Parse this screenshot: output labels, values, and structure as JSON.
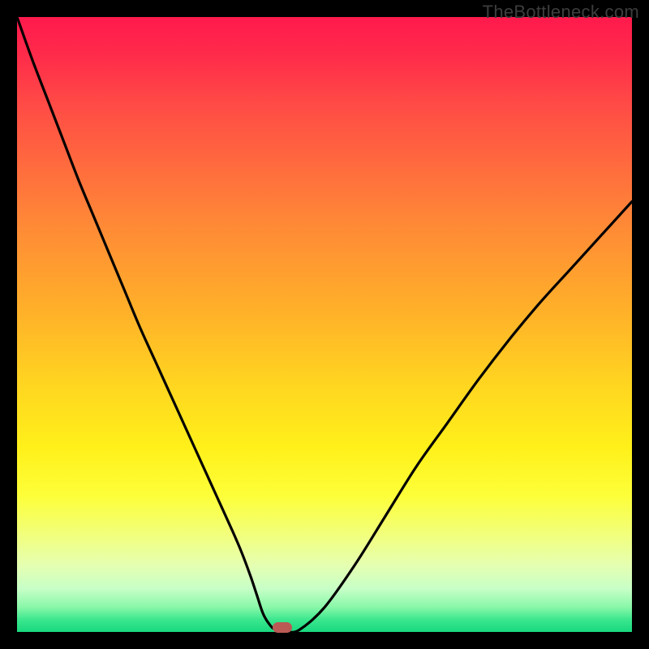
{
  "watermark": "TheBottleneck.com",
  "colors": {
    "frame": "#000000",
    "gradient_top": "#ff1a4d",
    "gradient_bottom": "#18d87e",
    "curve": "#000000",
    "marker": "#bb5a55"
  },
  "chart_data": {
    "type": "line",
    "title": "",
    "xlabel": "",
    "ylabel": "",
    "xlim": [
      0,
      100
    ],
    "ylim": [
      0,
      100
    ],
    "series": [
      {
        "name": "bottleneck-curve",
        "x": [
          0,
          2.5,
          5,
          7.5,
          10,
          12.5,
          15,
          17.5,
          20,
          22.5,
          25,
          27.5,
          30,
          32.5,
          35,
          36.5,
          38,
          39,
          40,
          41,
          42,
          44,
          46,
          50,
          55,
          60,
          65,
          70,
          75,
          80,
          85,
          90,
          95,
          100
        ],
        "y": [
          100,
          93,
          86.5,
          80,
          73.5,
          67.5,
          61.5,
          55.5,
          49.5,
          44,
          38.5,
          33,
          27.5,
          22,
          16.5,
          13,
          9,
          6,
          3,
          1.3,
          0.4,
          0,
          0.4,
          4,
          11,
          19,
          27,
          34,
          41,
          47.5,
          53.5,
          59,
          64.5,
          70
        ]
      }
    ],
    "annotations": [
      {
        "name": "optimal-marker",
        "x": 43.2,
        "y": 0.2
      }
    ]
  }
}
